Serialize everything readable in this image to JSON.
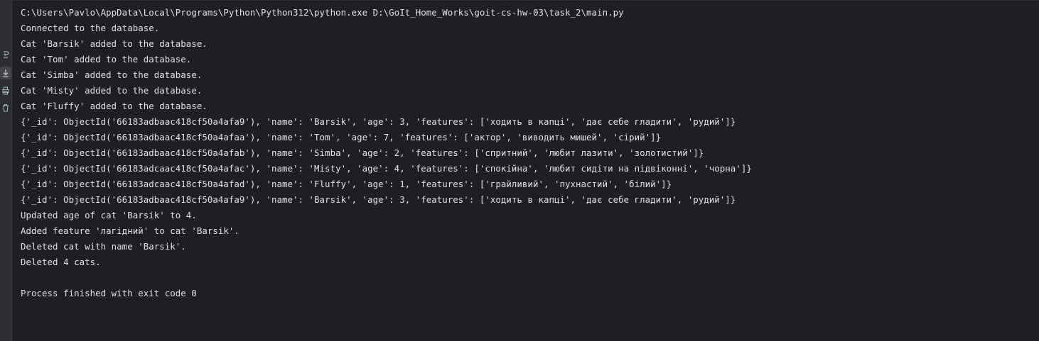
{
  "toolbar": {
    "icons": [
      "soft-wrap-icon",
      "scroll-to-end-icon",
      "print-icon",
      "clear-all-icon"
    ],
    "colors": {
      "gutter_background": "#2b2d30",
      "console_background": "#1e1f22",
      "text": "#dfe1e5",
      "icon": "#a8adbd"
    }
  },
  "console": {
    "lines": [
      "C:\\Users\\Pavlo\\AppData\\Local\\Programs\\Python\\Python312\\python.exe D:\\GoIt_Home_Works\\goit-cs-hw-03\\task_2\\main.py",
      "Connected to the database.",
      "Cat 'Barsik' added to the database.",
      "Cat 'Tom' added to the database.",
      "Cat 'Simba' added to the database.",
      "Cat 'Misty' added to the database.",
      "Cat 'Fluffy' added to the database.",
      "{'_id': ObjectId('66183adbaac418cf50a4afa9'), 'name': 'Barsik', 'age': 3, 'features': ['ходить в капці', 'дає себе гладити', 'рудий']}",
      "{'_id': ObjectId('66183adbaac418cf50a4afaa'), 'name': 'Tom', 'age': 7, 'features': ['актор', 'виводить мишей', 'сірий']}",
      "{'_id': ObjectId('66183adbaac418cf50a4afab'), 'name': 'Simba', 'age': 2, 'features': ['спритний', 'любит лазити', 'золотистий']}",
      "{'_id': ObjectId('66183adcaac418cf50a4afac'), 'name': 'Misty', 'age': 4, 'features': ['спокійна', 'любит сидіти на підвіконні', 'чорна']}",
      "{'_id': ObjectId('66183adcaac418cf50a4afad'), 'name': 'Fluffy', 'age': 1, 'features': ['грайливий', 'пухнастий', 'білий']}",
      "{'_id': ObjectId('66183adbaac418cf50a4afa9'), 'name': 'Barsik', 'age': 3, 'features': ['ходить в капці', 'дає себе гладити', 'рудий']}",
      "Updated age of cat 'Barsik' to 4.",
      "Added feature 'лагідний' to cat 'Barsik'.",
      "Deleted cat with name 'Barsik'.",
      "Deleted 4 cats.",
      "",
      "Process finished with exit code 0"
    ]
  }
}
